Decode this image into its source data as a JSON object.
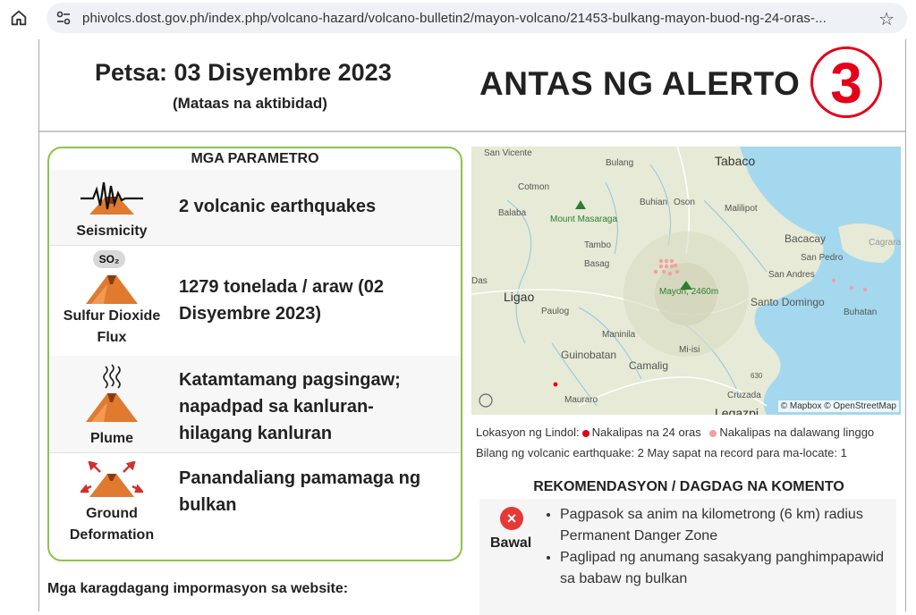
{
  "browser": {
    "url": "phivolcs.dost.gov.ph/index.php/volcano-hazard/volcano-bulletin2/mayon-volcano/21453-bulkang-mayon-buod-ng-24-oras-..."
  },
  "header": {
    "date": "Petsa: 03 Disyembre 2023",
    "activity": "(Mataas na aktibidad)",
    "alert_label": "ANTAS NG ALERTO",
    "alert_level": "3"
  },
  "params": {
    "title": "MGA PARAMETRO",
    "rows": [
      {
        "label": "Seismicity",
        "value": "2 volcanic earthquakes",
        "icon": "seismograph-volcano-icon"
      },
      {
        "label_line1": "Sulfur Dioxide",
        "label_line2": "Flux",
        "badge": "SO₂",
        "value": "1279 tonelada / araw (02 Disyembre 2023)",
        "icon": "so2-volcano-icon"
      },
      {
        "label": "Plume",
        "value": "Katamtamang pagsingaw; napadpad sa kanluran-hilagang kanluran",
        "icon": "steam-volcano-icon"
      },
      {
        "label_line1": "Ground",
        "label_line2": "Deformation",
        "value": "Panandaliang pamamaga ng bulkan",
        "icon": "inflation-volcano-icon"
      }
    ]
  },
  "map": {
    "labels": [
      "San Vicente",
      "Bulang",
      "Tabaco",
      "Cotmon",
      "Buhian",
      "Oson",
      "Malilipot",
      "Balaba",
      "Mount Masaraga",
      "Tambo",
      "Bacacay",
      "Basag",
      "San Pedro",
      "Cagraray",
      "Das",
      "Ligao",
      "Mayon, 2460m",
      "San Andres",
      "Santo Domingo",
      "Paulog",
      "Buhatan",
      "Maninila",
      "Guinobatan",
      "Mi-isi",
      "Camalig",
      "Mauraro",
      "Cruzada",
      "Legazpi",
      "630"
    ],
    "attribution": "© Mapbox © OpenStreetMap",
    "colors": {
      "water": "#a4d8ef",
      "land": "#e9eddc",
      "recent_quake": "#e4001b",
      "older_quake": "#f0a0a0"
    }
  },
  "legend": {
    "prefix": "Lokasyon ng Lindol:",
    "recent": "Nakalipas na 24 oras",
    "older": "Nakalipas na dalawang linggo",
    "count_line": "Bilang ng volcanic earthquake: 2   May sapat na record para ma-locate: 1"
  },
  "recommendations": {
    "title": "REKOMENDASYON / DAGDAG NA KOMENTO",
    "bawal_label": "Bawal",
    "items": [
      "Pagpasok sa anim na kilometrong (6 km) radius Permanent Danger Zone",
      "Paglipad ng anumang sasakyang panghimpapawid sa babaw ng bulkan"
    ]
  },
  "more_info": "Mga karagdagang impormasyon sa website:"
}
